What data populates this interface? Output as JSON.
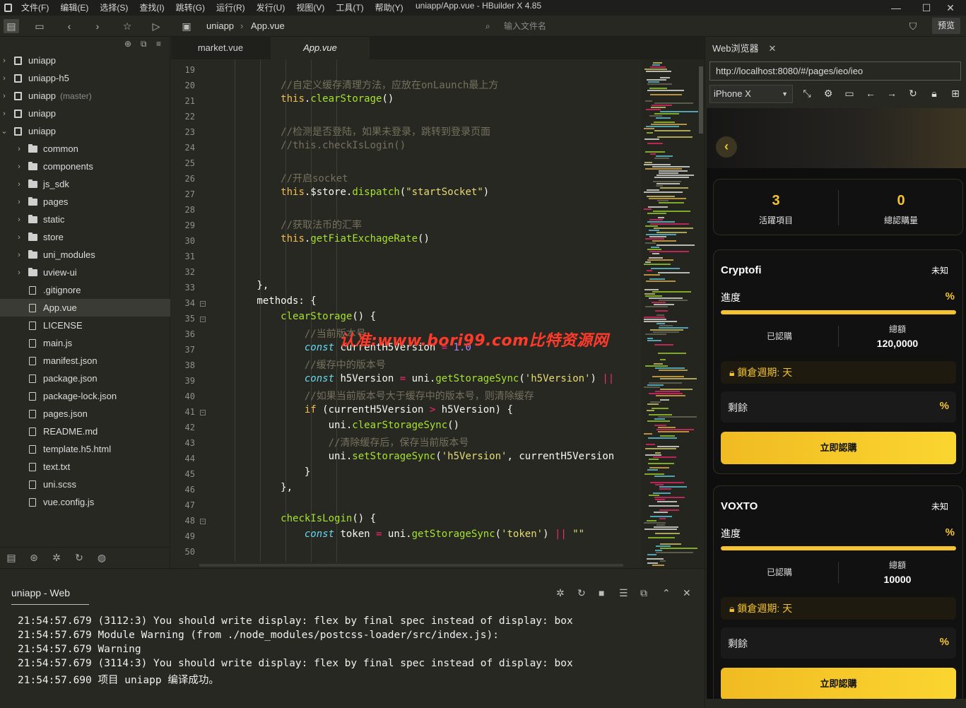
{
  "window": {
    "title": "uniapp/App.vue - HBuilder X 4.85",
    "menu": [
      "文件(F)",
      "编辑(E)",
      "选择(S)",
      "查找(I)",
      "跳转(G)",
      "运行(R)",
      "发行(U)",
      "视图(V)",
      "工具(T)",
      "帮助(Y)"
    ]
  },
  "toolbar": {
    "breadcrumb": [
      "uniapp",
      "App.vue"
    ],
    "search_placeholder": "输入文件名",
    "preview_label": "预览"
  },
  "sidebar": {
    "items": [
      {
        "label": "uniapp",
        "type": "project",
        "expanded": false
      },
      {
        "label": "uniapp-h5",
        "type": "project",
        "expanded": false
      },
      {
        "label": "uniapp",
        "type": "project",
        "expanded": false,
        "branch": "(master)"
      },
      {
        "label": "uniapp",
        "type": "project",
        "expanded": false
      },
      {
        "label": "uniapp",
        "type": "project",
        "expanded": true
      },
      {
        "label": "common",
        "type": "folder"
      },
      {
        "label": "components",
        "type": "folder"
      },
      {
        "label": "js_sdk",
        "type": "folder"
      },
      {
        "label": "pages",
        "type": "folder"
      },
      {
        "label": "static",
        "type": "folder"
      },
      {
        "label": "store",
        "type": "folder"
      },
      {
        "label": "uni_modules",
        "type": "folder"
      },
      {
        "label": "uview-ui",
        "type": "folder"
      },
      {
        "label": ".gitignore",
        "type": "file"
      },
      {
        "label": "App.vue",
        "type": "file",
        "active": true
      },
      {
        "label": "LICENSE",
        "type": "file"
      },
      {
        "label": "main.js",
        "type": "file"
      },
      {
        "label": "manifest.json",
        "type": "file"
      },
      {
        "label": "package.json",
        "type": "file"
      },
      {
        "label": "package-lock.json",
        "type": "file"
      },
      {
        "label": "pages.json",
        "type": "file"
      },
      {
        "label": "README.md",
        "type": "file"
      },
      {
        "label": "template.h5.html",
        "type": "file"
      },
      {
        "label": "text.txt",
        "type": "file"
      },
      {
        "label": "uni.scss",
        "type": "file"
      },
      {
        "label": "vue.config.js",
        "type": "file"
      }
    ]
  },
  "editor": {
    "tabs": [
      "market.vue",
      "App.vue"
    ],
    "active_tab": "App.vue",
    "line_numbers": [
      "19",
      "20",
      "21",
      "22",
      "23",
      "24",
      "25",
      "26",
      "27",
      "28",
      "29",
      "30",
      "31",
      "32",
      "33",
      "34",
      "35",
      "36",
      "37",
      "38",
      "39",
      "40",
      "41",
      "42",
      "43",
      "44",
      "45",
      "46",
      "47",
      "48",
      "49",
      "50"
    ],
    "watermark": "认准:www.bori99.com比特资源网"
  },
  "console": {
    "title": "uniapp - Web",
    "logs": [
      "21:54:57.679 (3112:3) You should write display: flex by final spec instead of display: box",
      "21:54:57.679 Module Warning (from ./node_modules/postcss-loader/src/index.js):",
      "21:54:57.679 Warning",
      "21:54:57.679 (3114:3) You should write display: flex by final spec instead of display: box",
      "21:54:57.690 项目 uniapp 编译成功。"
    ]
  },
  "browser": {
    "tab_label": "Web浏览器",
    "url": "http://localhost:8080/#/pages/ieo/ieo",
    "device": "iPhone X",
    "stats": [
      {
        "value": "3",
        "label": "活躍項目"
      },
      {
        "value": "0",
        "label": "總認購量"
      }
    ],
    "projects": [
      {
        "name": "Cryptofi",
        "status": "未知",
        "progress_label": "進度",
        "progress_pct": "%",
        "subscribed_label": "已認購",
        "total_label": "總額",
        "total_value": "120,0000",
        "lock_label": "鎖倉週期: 天",
        "remain_label": "剩餘",
        "remain_pct": "%",
        "button": "立即認購"
      },
      {
        "name": "VOXTO",
        "status": "未知",
        "progress_label": "進度",
        "progress_pct": "%",
        "subscribed_label": "已認購",
        "total_label": "總額",
        "total_value": "10000",
        "lock_label": "鎖倉週期: 天",
        "remain_label": "剩餘",
        "remain_pct": "%",
        "button": "立即認購"
      }
    ],
    "accent_color": "#f4c430"
  }
}
